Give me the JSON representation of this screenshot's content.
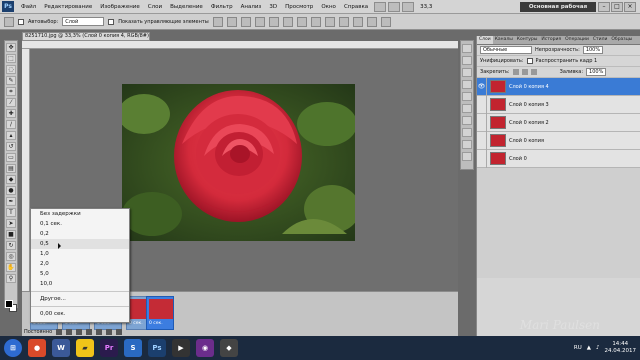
{
  "menubar": {
    "logo": "Ps",
    "items": [
      "Файл",
      "Редактирование",
      "Изображение",
      "Слои",
      "Выделение",
      "Фильтр",
      "Анализ",
      "3D",
      "Просмотр",
      "Окно",
      "Справка"
    ],
    "zoom": "33,3",
    "workspace": "Основная рабочая среда"
  },
  "optbar": {
    "autoselect_label": "Автовыбор:",
    "autoselect_value": "Слой",
    "transform_label": "Показать управляющие элементы"
  },
  "document": {
    "tab_title": "8251710.jpg @ 33,3% (Слой 0 копия 4, RGB/8#) *"
  },
  "layers_panel": {
    "tabs": [
      "Слои",
      "Каналы",
      "Контуры",
      "История",
      "Операции",
      "Стили",
      "Образцы"
    ],
    "blend_mode": "Обычные",
    "opacity_label": "Непрозрачность:",
    "opacity_value": "100%",
    "unify_label": "Унифицировать:",
    "propagate_label": "Распространить кадр 1",
    "lock_label": "Закрепить:",
    "fill_label": "Заливка:",
    "fill_value": "100%",
    "layers": [
      "Слой 0 копия 4",
      "Слой 0 копия 3",
      "Слой 0 копия 2",
      "Слой 0 копия",
      "Слой 0"
    ]
  },
  "anim": {
    "loop": "Постоянно",
    "frames": [
      "0 сек.",
      "0 сек.",
      "0 сек.",
      "0 сек.",
      "0 сек."
    ]
  },
  "delay_menu": {
    "items": [
      "Без задержки",
      "0,1 сек.",
      "0,2",
      "0,5",
      "1,0",
      "2,0",
      "5,0",
      "10,0",
      "Другое...",
      "0,00 сек."
    ]
  },
  "taskbar": {
    "lang": "RU",
    "time": "14:44",
    "date": "24.04.2017"
  },
  "watermark": "Mari Paulsen"
}
